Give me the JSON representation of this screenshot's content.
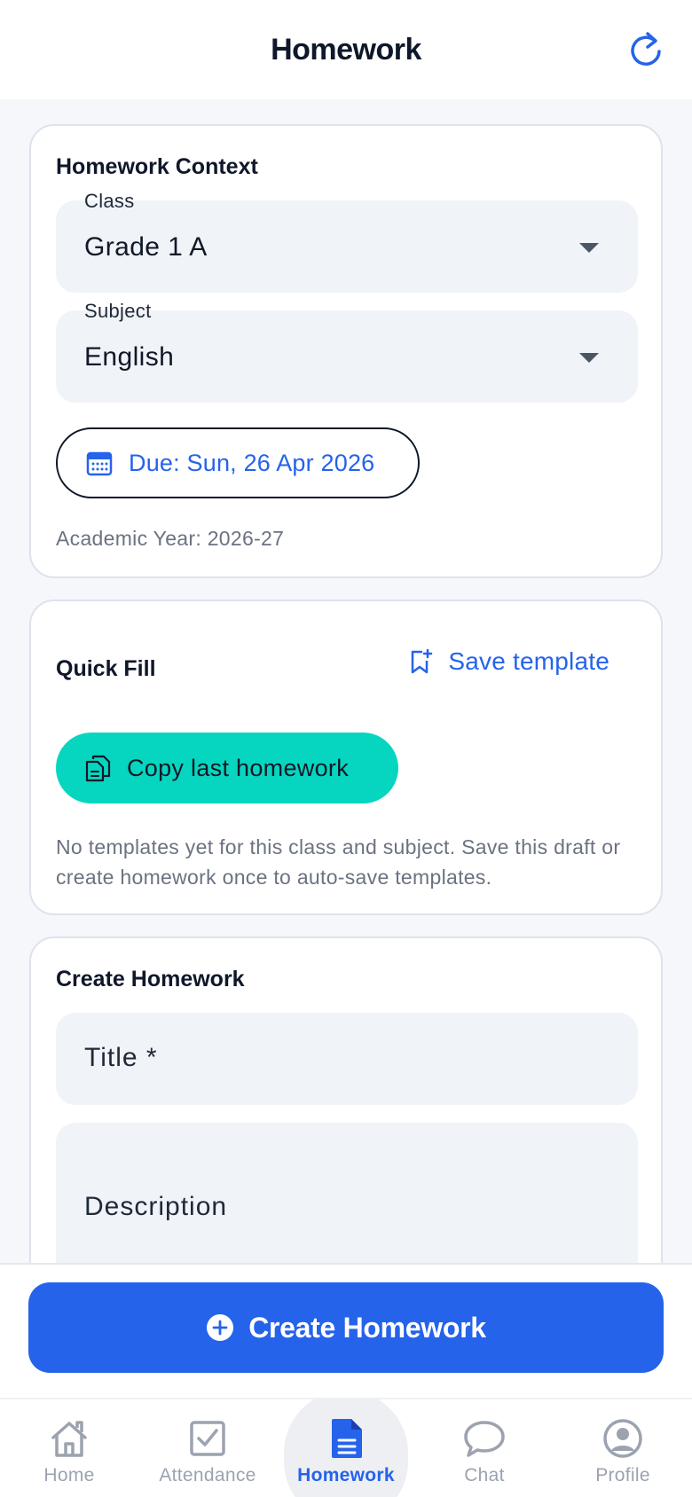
{
  "header": {
    "title": "Homework"
  },
  "context": {
    "title": "Homework Context",
    "class_label": "Class",
    "class_value": "Grade 1 A",
    "subject_label": "Subject",
    "subject_value": "English",
    "due_label": "Due: Sun, 26 Apr 2026",
    "academic_year": "Academic Year: 2026-27"
  },
  "quick_fill": {
    "title": "Quick Fill",
    "save_template_label": "Save template",
    "copy_last_label": "Copy last homework",
    "hint": "No templates yet for this class and subject. Save this draft or create homework once to auto-save templates."
  },
  "create": {
    "title": "Create Homework",
    "title_placeholder": "Title *",
    "description_placeholder": "Description"
  },
  "action": {
    "create_label": "Create Homework"
  },
  "nav": {
    "items": [
      {
        "label": "Home",
        "icon": "home-icon"
      },
      {
        "label": "Attendance",
        "icon": "checkbox-icon"
      },
      {
        "label": "Homework",
        "icon": "document-icon"
      },
      {
        "label": "Chat",
        "icon": "chat-bubble-icon"
      },
      {
        "label": "Profile",
        "icon": "user-circle-icon"
      }
    ],
    "active": "Homework"
  },
  "colors": {
    "primary": "#2563eb",
    "accent_teal": "#06d6bf",
    "text_dark": "#0f172a",
    "muted": "#6b7280",
    "field_bg": "#f0f3f8"
  }
}
